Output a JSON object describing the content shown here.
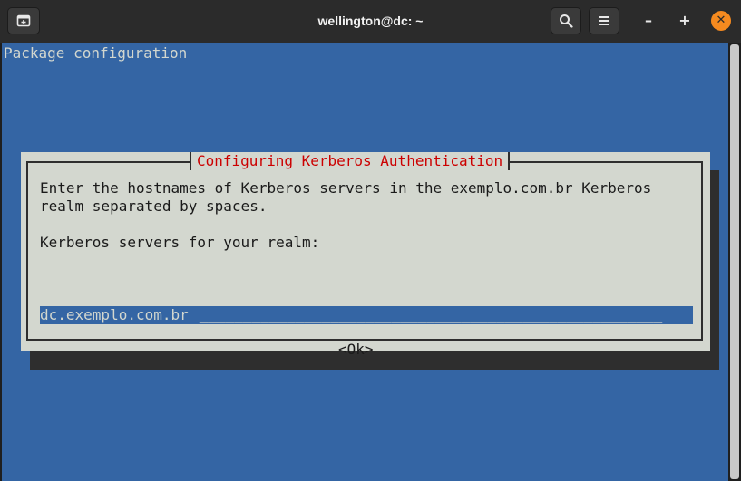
{
  "window": {
    "title": "wellington@dc: ~"
  },
  "titlebar": {
    "new_tab_icon": "new-tab-icon",
    "search_icon": "search-icon",
    "menu_icon": "hamburger-menu-icon",
    "minimize_label": "–",
    "maximize_label": "+",
    "close_label": "✕"
  },
  "terminal": {
    "header": "Package configuration"
  },
  "dialog": {
    "title": "Configuring Kerberos Authentication",
    "line1": "Enter the hostnames of Kerberos servers in the exemplo.com.br Kerberos",
    "line2": "realm separated by spaces.",
    "prompt": "Kerberos servers for your realm:",
    "input_value": "dc.exemplo.com.br",
    "ok_label": "<Ok>"
  },
  "colors": {
    "terminal_background": "#3465a4",
    "dialog_background": "#d3d7cf",
    "dialog_title": "#cc0000",
    "close_button": "#f58a1f"
  }
}
